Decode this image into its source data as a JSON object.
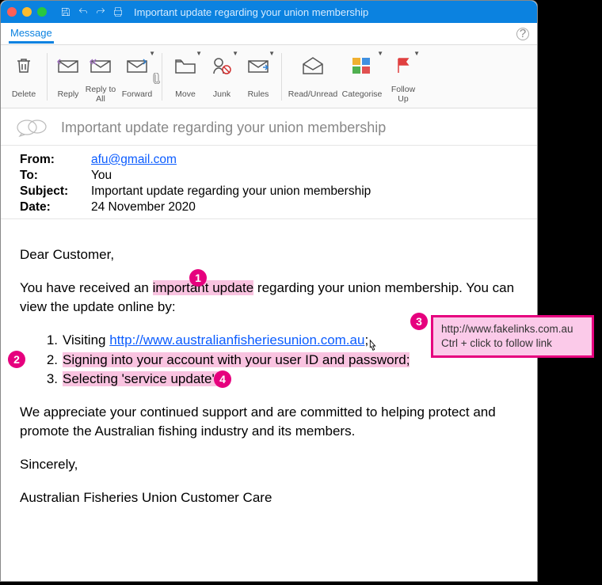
{
  "titlebar": {
    "title": "Important update regarding your union membership"
  },
  "tab": {
    "label": "Message"
  },
  "ribbon": {
    "delete": "Delete",
    "reply": "Reply",
    "reply_all": "Reply to All",
    "forward": "Forward",
    "move": "Move",
    "junk": "Junk",
    "rules": "Rules",
    "read_unread": "Read/Unread",
    "categorise": "Categorise",
    "follow_up": "Follow Up"
  },
  "subject_line": "Important update regarding your union membership",
  "headers": {
    "from_label": "From:",
    "from_value": "afu@gmail.com",
    "to_label": "To:",
    "to_value": "You",
    "subject_label": "Subject:",
    "subject_value": "Important update regarding your union membership",
    "date_label": "Date:",
    "date_value": "24 November 2020"
  },
  "body": {
    "greeting": "Dear Customer,",
    "line1_a": "You have received an ",
    "line1_hl": "important update",
    "line1_b": " regarding your union membership. You can view the update online by:",
    "steps": [
      {
        "num": "1.",
        "pre": "Visiting ",
        "link": "http://www.australianfisheriesunion.com.au",
        "post": ";"
      },
      {
        "num": "2.",
        "text": "Signing into your account with your user ID and password;"
      },
      {
        "num": "3.",
        "text": "Selecting 'service update'."
      }
    ],
    "para2": "We appreciate your continued support and are committed to helping protect and promote the Australian fishing industry and its members.",
    "signoff": "Sincerely,",
    "signature": "Australian Fisheries Union Customer Care"
  },
  "tooltip": {
    "url": "http://www.fakelinks.com.au",
    "hint": "Ctrl + click to follow link"
  },
  "callouts": {
    "c1": "1",
    "c2": "2",
    "c3": "3",
    "c4": "4"
  }
}
